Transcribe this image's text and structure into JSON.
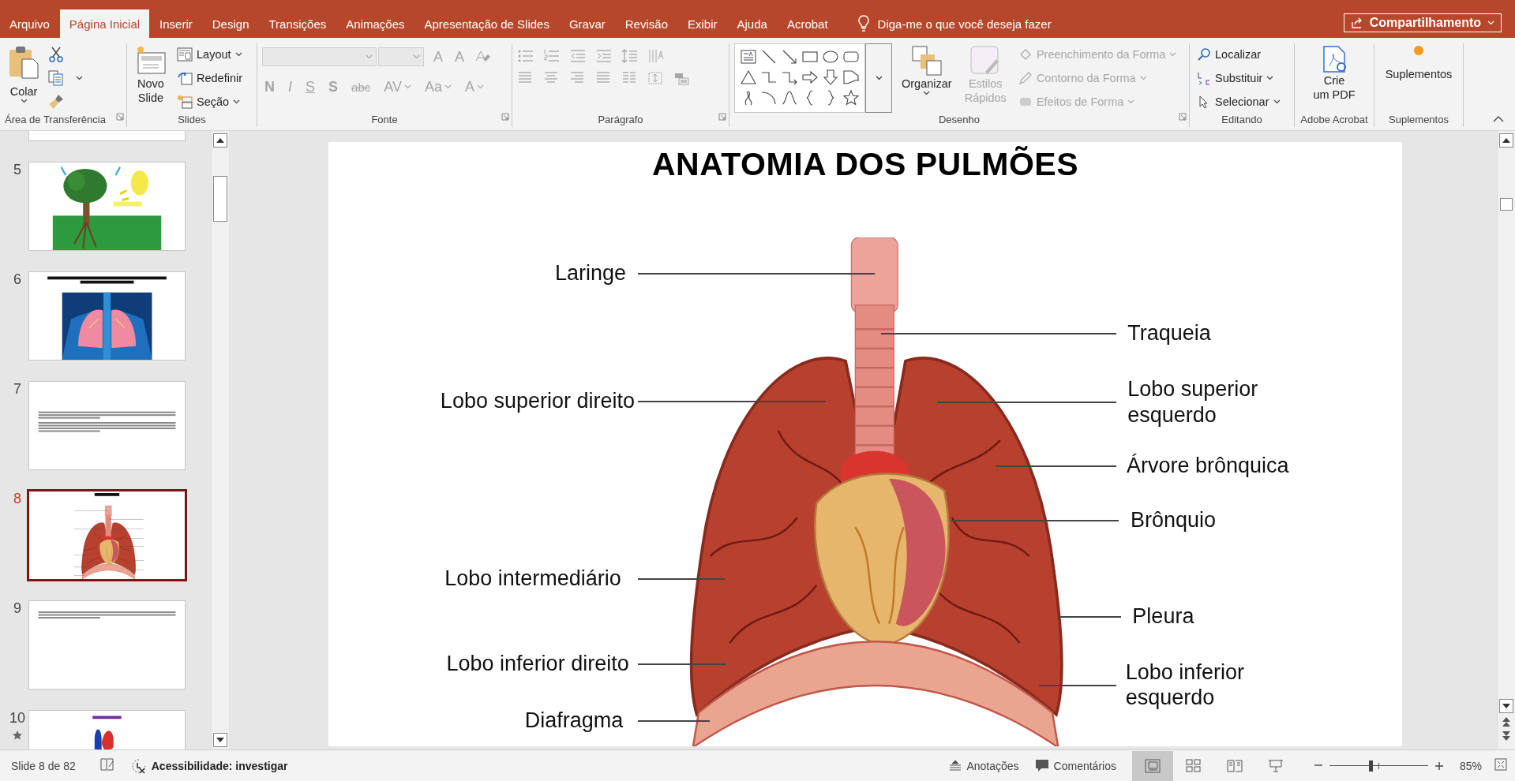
{
  "tabs": [
    {
      "label": "Arquivo",
      "selected": false
    },
    {
      "label": "Página Inicial",
      "selected": true
    },
    {
      "label": "Inserir",
      "selected": false
    },
    {
      "label": "Design",
      "selected": false
    },
    {
      "label": "Transições",
      "selected": false
    },
    {
      "label": "Animações",
      "selected": false
    },
    {
      "label": "Apresentação de Slides",
      "selected": false
    },
    {
      "label": "Gravar",
      "selected": false
    },
    {
      "label": "Revisão",
      "selected": false
    },
    {
      "label": "Exibir",
      "selected": false
    },
    {
      "label": "Ajuda",
      "selected": false
    },
    {
      "label": "Acrobat",
      "selected": false
    }
  ],
  "tell_me": "Diga-me o que você deseja fazer",
  "share_button": "Compartilhamento",
  "ribbon": {
    "clipboard": {
      "label": "Área de Transferência",
      "paste": "Colar"
    },
    "slides": {
      "label": "Slides",
      "new_slide": "Novo\nSlide",
      "items": [
        "Layout",
        "Redefinir",
        "Seção"
      ]
    },
    "font": {
      "label": "Fonte",
      "disabled": true,
      "buttons": [
        "A",
        "A",
        "N",
        "I",
        "S",
        "S",
        "abc",
        "AV",
        "Aa",
        "A"
      ]
    },
    "paragraph": {
      "label": "Parágrafo",
      "disabled": true
    },
    "drawing": {
      "label": "Desenho",
      "arrange": "Organizar",
      "quick_styles": {
        "label": "Estilos\nRápidos",
        "disabled": true
      },
      "format": [
        {
          "label": "Preenchimento da Forma",
          "disabled": true
        },
        {
          "label": "Contorno da Forma",
          "disabled": true
        },
        {
          "label": "Efeitos de Forma",
          "disabled": true
        }
      ]
    },
    "editing": {
      "label": "Editando",
      "items": [
        "Localizar",
        "Substituir",
        "Selecionar"
      ]
    },
    "acrobat": {
      "label": "Adobe Acrobat",
      "button": "Crie\num PDF"
    },
    "addins": {
      "label": "Suplementos",
      "button": "Suplementos"
    }
  },
  "thumbnails": [
    {
      "kind": "cut",
      "selected": false
    },
    {
      "kind": "picture",
      "number": "5",
      "selected": false,
      "animated": false
    },
    {
      "kind": "title_picture",
      "number": "6",
      "selected": false,
      "animated": false
    },
    {
      "kind": "text",
      "number": "7",
      "selected": false,
      "animated": false
    },
    {
      "kind": "anatomy",
      "number": "8",
      "selected": true,
      "animated": false
    },
    {
      "kind": "text",
      "number": "9",
      "selected": false,
      "animated": false
    },
    {
      "kind": "heart",
      "number": "10",
      "selected": false,
      "animated": true
    }
  ],
  "slide": {
    "title": "ANATOMIA DOS PULMÕES",
    "labels": [
      "Laringe",
      "Traqueia",
      "Lobo superior direito",
      "Lobo superior\nesquerdo",
      "Árvore brônquica",
      "Brônquio",
      "Lobo intermediário",
      "Pleura",
      "Lobo inferior direito",
      "Lobo inferior\nesquerdo",
      "Diafragma"
    ]
  },
  "status_bar": {
    "slide_info": "Slide 8 de 82",
    "accessibility": "Acessibilidade: investigar",
    "notes": "Anotações",
    "comments": "Comentários",
    "views": [
      {
        "selected": true
      },
      {
        "selected": false
      },
      {
        "selected": false
      },
      {
        "selected": false
      }
    ],
    "zoom": {
      "level": 0.42,
      "reading": "85%"
    }
  }
}
